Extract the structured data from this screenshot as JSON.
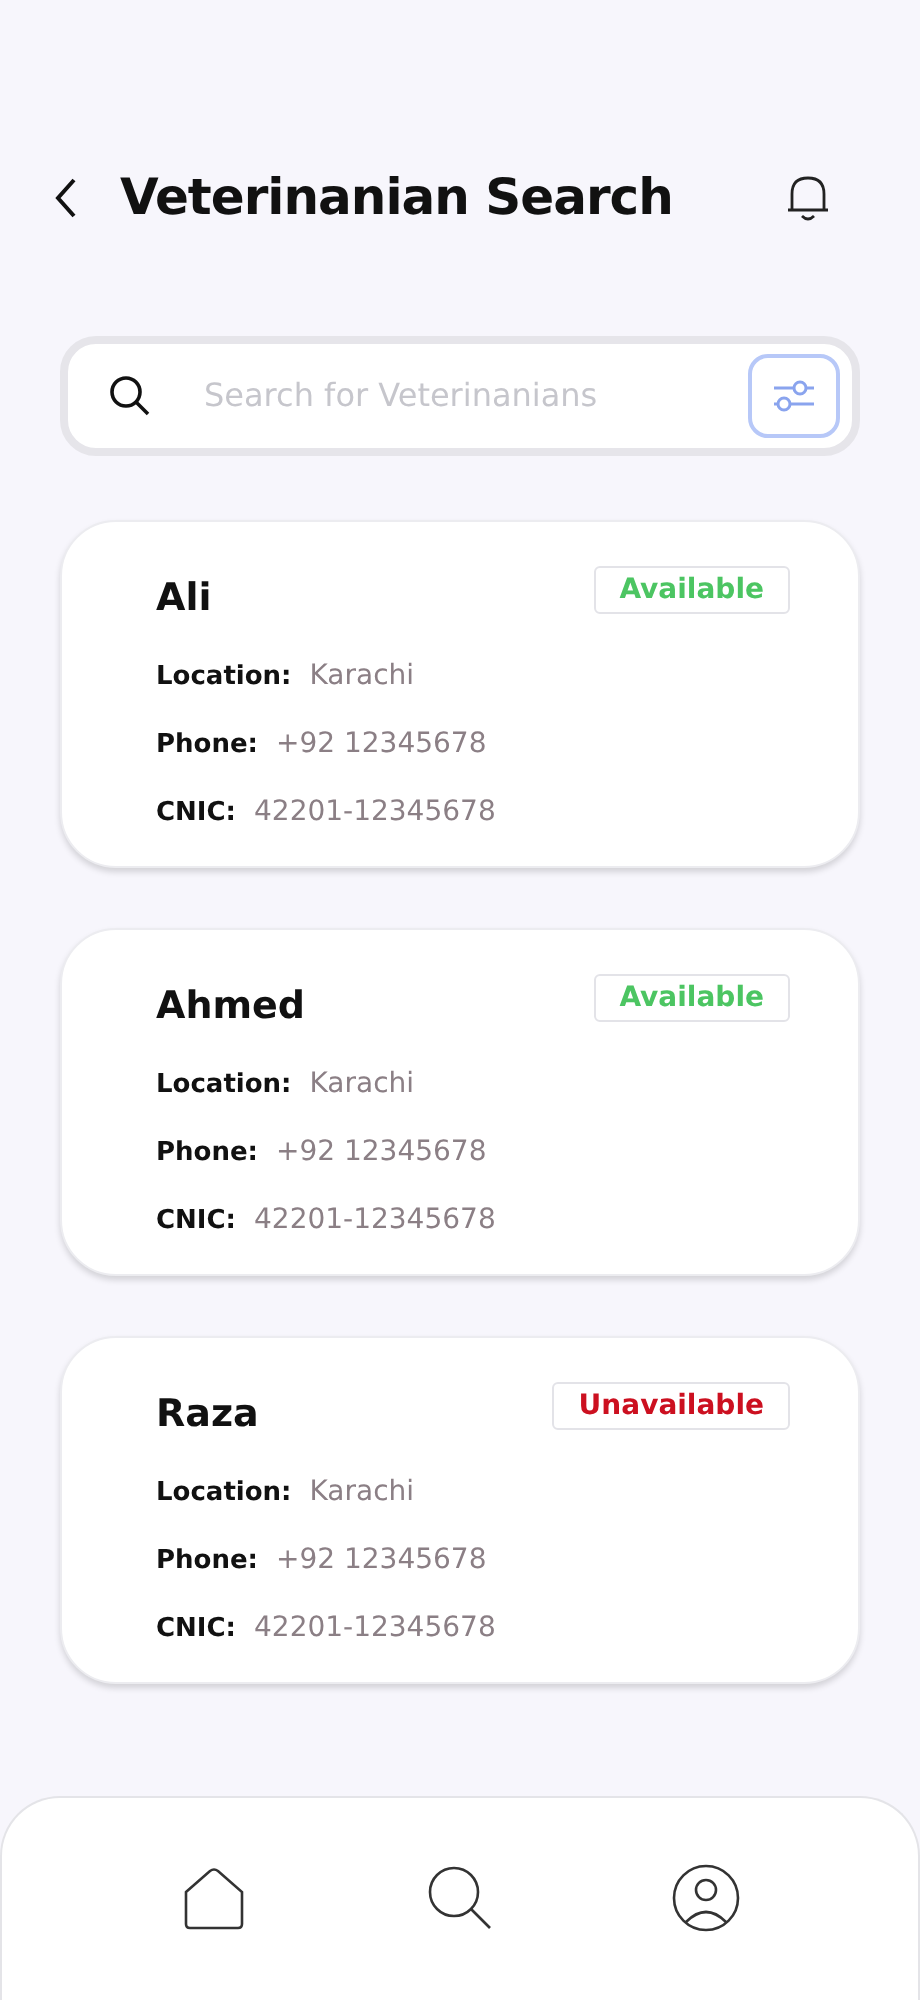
{
  "header": {
    "title": "Veterinanian Search"
  },
  "search": {
    "placeholder": "Search for Veterinanians"
  },
  "vets": [
    {
      "name": "Ali",
      "status": "Available",
      "available": true,
      "fields": [
        {
          "label": "Location:",
          "value": "Karachi"
        },
        {
          "label": "Phone:",
          "value": "+92 12345678"
        },
        {
          "label": "CNIC:",
          "value": "42201-12345678"
        }
      ]
    },
    {
      "name": "Ahmed",
      "status": "Available",
      "available": true,
      "fields": [
        {
          "label": "Location:",
          "value": "Karachi"
        },
        {
          "label": "Phone:",
          "value": "+92 12345678"
        },
        {
          "label": "CNIC:",
          "value": "42201-12345678"
        }
      ]
    },
    {
      "name": "Raza",
      "status": "Unavailable",
      "available": false,
      "fields": [
        {
          "label": "Location:",
          "value": "Karachi"
        },
        {
          "label": "Phone:",
          "value": "+92 12345678"
        },
        {
          "label": "CNIC:",
          "value": "42201-12345678"
        }
      ]
    }
  ],
  "nav": [
    {
      "kind": "home"
    },
    {
      "kind": "search"
    },
    {
      "kind": "profile"
    }
  ]
}
